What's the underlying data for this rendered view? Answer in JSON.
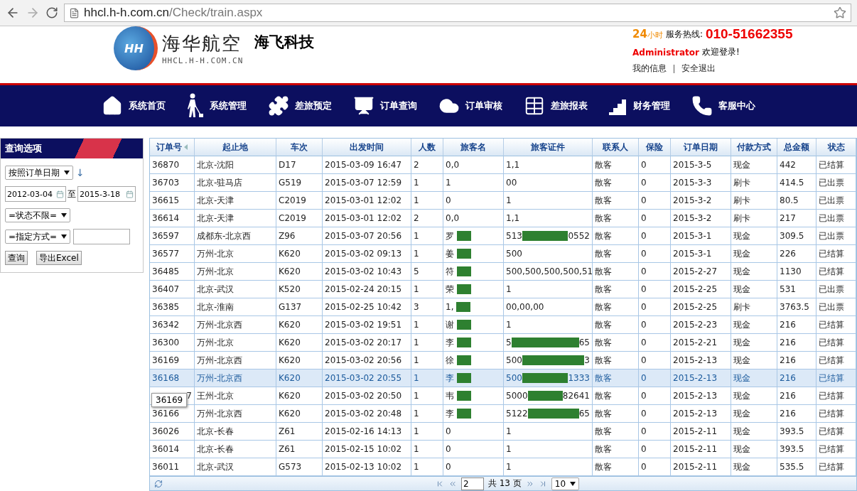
{
  "browser": {
    "url_host": "hhcl.h-h.com.cn",
    "url_path": "/Check/train.aspx"
  },
  "header": {
    "logo_mark": "HH",
    "logo_title": "海华航空",
    "logo_domain": "HHCL.H-H.COM.CN",
    "company": "海飞科技",
    "hotline_badge": "24",
    "hotline_badge_suffix": "小时",
    "hotline_label": "服务热线:",
    "hotline": "010-51662355",
    "user": "Administrator",
    "welcome": "欢迎登录!",
    "links": [
      "我的信息",
      "安全退出"
    ]
  },
  "nav": [
    "系统首页",
    "系统管理",
    "差旅预定",
    "订单查询",
    "订单审核",
    "差旅报表",
    "财务管理",
    "客服中心"
  ],
  "query": {
    "title": "查询选项",
    "sort_select": "按照订单日期",
    "sort_arrow": "↓",
    "date_from": "2012-03-04",
    "date_sep": "至",
    "date_to": "2015-3-18",
    "status_select": "=状态不限=",
    "mode_select": "=指定方式=",
    "buttons": [
      "查询",
      "导出Excel"
    ]
  },
  "table": {
    "columns": [
      {
        "label": "订单号",
        "sorted": true
      },
      {
        "label": "起止地",
        "sorted": false
      },
      {
        "label": "车次",
        "sorted": false
      },
      {
        "label": "出发时间",
        "sorted": false
      },
      {
        "label": "人数",
        "sorted": false
      },
      {
        "label": "旅客名",
        "sorted": false
      },
      {
        "label": "旅客证件",
        "sorted": false
      },
      {
        "label": "联系人",
        "sorted": false
      },
      {
        "label": "保险",
        "sorted": false
      },
      {
        "label": "订单日期",
        "sorted": false
      },
      {
        "label": "付款方式",
        "sorted": false
      },
      {
        "label": "总金额",
        "sorted": false
      },
      {
        "label": "状态",
        "sorted": false
      }
    ],
    "rows": [
      {
        "cells": [
          "36870",
          "北京-沈阳",
          "D17",
          "2015-03-09 16:47",
          "2",
          "0,0",
          "1,1",
          "散客",
          "0",
          "2015-3-5",
          "现金",
          "442",
          "已结算"
        ],
        "selected": false,
        "redacted": false
      },
      {
        "cells": [
          "36703",
          "北京-驻马店",
          "G519",
          "2015-03-07 12:59",
          "1",
          "1",
          "00",
          "散客",
          "0",
          "2015-3-3",
          "刷卡",
          "414.5",
          "已出票"
        ],
        "selected": false,
        "redacted": false
      },
      {
        "cells": [
          "36615",
          "北京-天津",
          "C2019",
          "2015-03-01 12:02",
          "1",
          "0",
          "1",
          "散客",
          "0",
          "2015-3-2",
          "刷卡",
          "80.5",
          "已出票"
        ],
        "selected": false,
        "redacted": false
      },
      {
        "cells": [
          "36614",
          "北京-天津",
          "C2019",
          "2015-03-01 12:02",
          "2",
          "0,0",
          "1,1",
          "散客",
          "0",
          "2015-3-2",
          "刷卡",
          "217",
          "已出票"
        ],
        "selected": false,
        "redacted": false
      },
      {
        "cells": [
          "36597",
          "成都东-北京西",
          "Z96",
          "2015-03-07 20:56",
          "1",
          "罗",
          "513",
          "散客",
          "0",
          "2015-3-1",
          "现金",
          "309.5",
          "已出票"
        ],
        "id_end": "0552",
        "selected": false,
        "redacted": true
      },
      {
        "cells": [
          "36577",
          "万州-北京",
          "K620",
          "2015-03-02 09:13",
          "1",
          "姜",
          "500",
          "散客",
          "0",
          "2015-3-1",
          "现金",
          "226",
          "已结算"
        ],
        "selected": false,
        "redacted": true
      },
      {
        "cells": [
          "36485",
          "万州-北京",
          "K620",
          "2015-03-02 10:43",
          "5",
          "符",
          "500,500,500,500,51",
          "散客",
          "0",
          "2015-2-27",
          "现金",
          "1130",
          "已结算"
        ],
        "selected": false,
        "redacted": true
      },
      {
        "cells": [
          "36407",
          "北京-武汉",
          "K520",
          "2015-02-24 20:15",
          "1",
          "荣",
          "1",
          "散客",
          "0",
          "2015-2-25",
          "现金",
          "531",
          "已出票"
        ],
        "selected": false,
        "redacted": true
      },
      {
        "cells": [
          "36385",
          "北京-淮南",
          "G137",
          "2015-02-25 10:42",
          "3",
          "1,",
          "00,00,00",
          "散客",
          "0",
          "2015-2-25",
          "刷卡",
          "3763.5",
          "已出票"
        ],
        "selected": false,
        "redacted": true
      },
      {
        "cells": [
          "36342",
          "万州-北京西",
          "K620",
          "2015-03-02 19:51",
          "1",
          "谢",
          "1",
          "散客",
          "0",
          "2015-2-23",
          "现金",
          "216",
          "已结算"
        ],
        "selected": false,
        "redacted": true
      },
      {
        "cells": [
          "36300",
          "万州-北京",
          "K620",
          "2015-03-02 20:17",
          "1",
          "李",
          "5",
          "散客",
          "0",
          "2015-2-21",
          "现金",
          "216",
          "已结算"
        ],
        "id_end": "65",
        "selected": false,
        "redacted": true
      },
      {
        "cells": [
          "36169",
          "万州-北京西",
          "K620",
          "2015-03-02 20:56",
          "1",
          "徐",
          "500",
          "散客",
          "0",
          "2015-2-13",
          "现金",
          "216",
          "已结算"
        ],
        "id_end": "3",
        "selected": false,
        "redacted": true
      },
      {
        "cells": [
          "36168",
          "万州-北京西",
          "K620",
          "2015-03-02 20:55",
          "1",
          "李",
          "500",
          "散客",
          "0",
          "2015-2-13",
          "现金",
          "216",
          "已结算"
        ],
        "id_end": "1333",
        "selected": true,
        "redacted": true
      },
      {
        "cells": [
          "7",
          "王州-北京",
          "K620",
          "2015-03-02 20:50",
          "1",
          "韦",
          "5000",
          "散客",
          "0",
          "2015-2-13",
          "现金",
          "216",
          "已结算"
        ],
        "id_end": "82641",
        "selected": false,
        "redacted": true
      },
      {
        "cells": [
          "36166",
          "万州-北京西",
          "K620",
          "2015-03-02 20:48",
          "1",
          "李",
          "5122",
          "散客",
          "0",
          "2015-2-13",
          "现金",
          "216",
          "已结算"
        ],
        "id_end": "65",
        "selected": false,
        "redacted": true
      },
      {
        "cells": [
          "36026",
          "北京-长春",
          "Z61",
          "2015-02-16 14:13",
          "1",
          "0",
          "1",
          "散客",
          "0",
          "2015-2-11",
          "现金",
          "393.5",
          "已结算"
        ],
        "selected": false,
        "redacted": false
      },
      {
        "cells": [
          "36014",
          "北京-长春",
          "Z61",
          "2015-02-15 10:02",
          "1",
          "0",
          "1",
          "散客",
          "0",
          "2015-2-11",
          "现金",
          "393.5",
          "已结算"
        ],
        "selected": false,
        "redacted": false
      },
      {
        "cells": [
          "36011",
          "北京-武汉",
          "G573",
          "2015-02-13 10:02",
          "1",
          "0",
          "1",
          "散客",
          "0",
          "2015-2-11",
          "现金",
          "535.5",
          "已结算"
        ],
        "selected": false,
        "redacted": false
      }
    ],
    "tooltip": "36169",
    "pager": {
      "page": "2",
      "total": "共 13 页",
      "page_size": "10"
    }
  }
}
